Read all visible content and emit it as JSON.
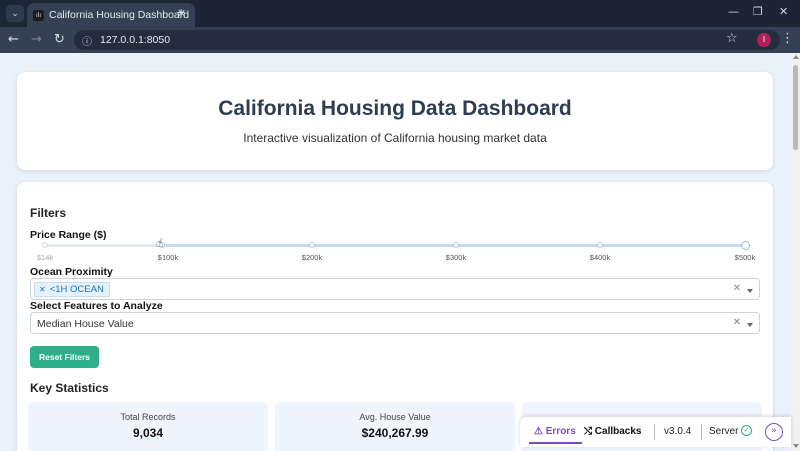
{
  "browser": {
    "tab_title": "California Housing Dashboard",
    "favicon_text": "ılı",
    "url": "127.0.0.1:8050",
    "profile_initial": "I"
  },
  "header": {
    "title": "California Housing Data Dashboard",
    "subtitle": "Interactive visualization of California housing market data"
  },
  "filters": {
    "heading": "Filters",
    "price_range": {
      "label": "Price Range ($)",
      "ticks": [
        "$14k",
        "$100k",
        "$200k",
        "$300k",
        "$400k",
        "$500k"
      ],
      "selected_low": "$100k",
      "selected_high": "$500k"
    },
    "ocean_proximity": {
      "label": "Ocean Proximity",
      "selected": [
        "<1H OCEAN"
      ]
    },
    "features": {
      "label": "Select Features to Analyze",
      "selected": "Median House Value"
    },
    "reset_label": "Reset Filters"
  },
  "stats": {
    "heading": "Key Statistics",
    "cards": [
      {
        "label": "Total Records",
        "value": "9,034"
      },
      {
        "label": "Avg. House Value",
        "value": "$240,267.99"
      }
    ]
  },
  "debug": {
    "errors_label": "Errors",
    "callbacks_label": "Callbacks",
    "version": "v3.0.4",
    "server_label": "Server"
  },
  "colors": {
    "accent_green": "#2bb08a",
    "title_color": "#2c3e50",
    "debug_purple": "#7a4dbf",
    "page_bg": "#e9f1fb"
  }
}
